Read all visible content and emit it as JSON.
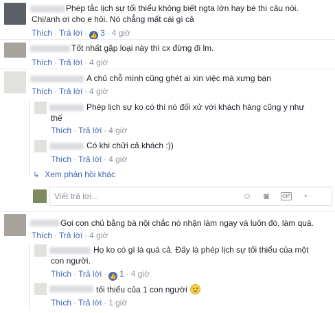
{
  "common": {
    "like": "Thích",
    "reply": "Trả lời",
    "dot": "·"
  },
  "comments": [
    {
      "text_lines": [
        "Phép tắc lịch sự tối thiểu không biết ngta lớn hay bé thì câu nói.",
        "Chị/anh ơi cho e hỏi. Nó chẳng mất cái gì cả"
      ],
      "likes": "3",
      "time": "4 giờ"
    },
    {
      "text_lines": [
        "Tốt nhất gặp loại này thì cx đừng đi lm."
      ],
      "time": "4 giờ"
    },
    {
      "text_lines": [
        "A chủ chỗ mình cũng ghét ai xin việc mà xưng bạn"
      ],
      "time": "4 giờ"
    },
    {
      "text_lines": [
        "Phép lịch sự ko có thì nó đối xử với khách hàng cũng y như",
        "thế"
      ],
      "time": "4 giờ"
    },
    {
      "text_lines": [
        "Có khi chửi cả khách :))"
      ],
      "time": "4 giờ"
    },
    {
      "text_lines": [
        "Gọi con chủ bằng bà nội chắc nó nhận làm ngay và luôn đó, làm quá."
      ],
      "time": "4 giờ"
    },
    {
      "text_lines": [
        "Họ ko có gì là quá cả. Đấy là phép lịch sự tối thiểu của một",
        "con người."
      ],
      "likes": "1",
      "time": "4 giờ"
    },
    {
      "text_lines": [
        "tối thiểu của 1 con người"
      ],
      "time": "1 giờ"
    }
  ],
  "more_replies": "Xem phản hồi khác",
  "reply_box": {
    "placeholder": "Viết trả lời..."
  }
}
